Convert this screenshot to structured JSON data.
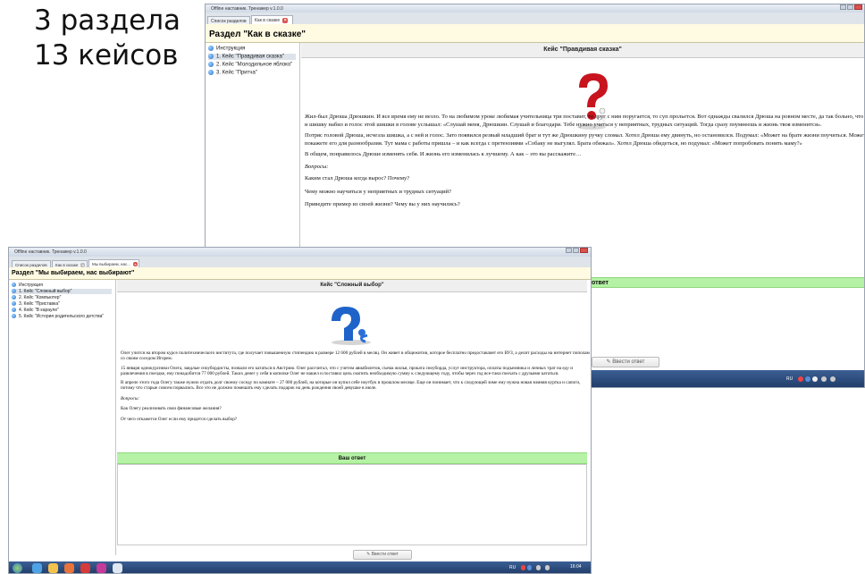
{
  "heading": {
    "line1": "3 раздела",
    "line2": "13 кейсов"
  },
  "window_back": {
    "title": "Offline наставник. Тренажер v.1.0.0",
    "tabs": [
      {
        "label": "Список разделов"
      },
      {
        "label": "Как в сказке"
      }
    ],
    "section_title": "Раздел \"Как в сказке\"",
    "sidebar": [
      {
        "label": "Инструкция"
      },
      {
        "label": "1. Кейс \"Правдивая сказка\""
      },
      {
        "label": "2. Кейс \"Молодильное яблоко\""
      },
      {
        "label": "3. Кейс \"Притча\""
      }
    ],
    "case_title": "Кейс \"Правдивая сказка\"",
    "paragraphs": [
      "Жил-был Дрюша Дрюшкин. И все время ему не везло. То на любимом уроке любимая учительница три поставит, то друг с ним поругается, то суп прольется. Вот однажды свалился Дрюша на ровном месте, да так больно, что и шишку набил и голос этой шишки в голове услышал: «Слушай меня, Дрюшкин. Слушай и благодари. Тебе нужно учиться у неприятных, трудных ситуаций. Тогда сразу поумнеешь и жизнь твоя изменится».",
      "Потряс головой Дрюша, исчезла шишка, а с ней и голос. Зато появился резвый младший брат и тут же Дрюшкину ручку сломал. Хотел Дрюша ему двинуть, но остановился. Подумал: «Может на брате жизни поучиться. Может покажете его для разнообразия. Тут мама с работы пришла – и как всегда с претензиями «Собаку не выгулял. Брата обижал». Хотел Дрюша обидеться, но подумал: «Может попробовать понять маму?»",
      "В общем, понравилось Дрюше изменять себя. И жизнь его изменилась к лучшему. А как – это вы расскажите…"
    ],
    "questions_label": "Вопросы:",
    "questions": [
      "Каким стал Дрюша когда вырос? Почему?",
      "Чему можно научиться у неприятных и трудных ситуаций?",
      "Приведите пример из своей жизни? Чему вы у них научились?"
    ],
    "answer_label": "ответ",
    "enter_answer_button": "Ввести ответ",
    "tray_lang": "RU"
  },
  "window_front": {
    "title": "Offline наставник. Тренажер v.1.0.0",
    "tabs": [
      {
        "label": "Список разделов"
      },
      {
        "label": "Как в сказке"
      },
      {
        "label": "Мы выбираем, нас..."
      }
    ],
    "section_title": "Раздел \"Мы выбираем, нас выбирают\"",
    "sidebar": [
      {
        "label": "Инструкция"
      },
      {
        "label": "1. Кейс \"Сложный выбор\""
      },
      {
        "label": "2. Кейс \"Компьютер\""
      },
      {
        "label": "3. Кейс \"Приставка\""
      },
      {
        "label": "4. Кейс \"В караулe\""
      },
      {
        "label": "5. Кейс \"История родительского детства\""
      }
    ],
    "case_title": "Кейс \"Сложный выбор\"",
    "paragraphs": [
      "Олег учится на втором курсе политехнического института, где получает повышенную стипендию в размере 12 600 рублей в месяц. Он живет в общежитии, которое бесплатно предоставляет его ВУЗ, а делит расходы на интернет пополам со своим соседом Игорем.",
      "15 января однокурсники Олега, заядлые сноубордисты, позвали его кататься в Австрию. Олег рассчитал, что с учетом авиабилетов, съема жилья, проката сноуборда, услуг инструктора, оплаты подъемника и личных трат на еду и развлечения в поездке, ему понадобится 77 000 рублей. Таких денег у себя в копилке Олег не нашел и поставил цель скопить необходимую сумму к следующему году, чтобы через год все-таки поехать с друзьями кататься.",
      "В апреле этого года Олегу также нужно отдать долг своему соседу по комнате – 27 000 рублей, на которые он купил себе ноутбук в прошлом месяце. Еще он понимает, что к следующей зиме ему нужна новая зимняя куртка и сапоги, потому что старые совсем порвались. Все это не должно помешать ему сделать подарок на день рождения своей девушке в июле."
    ],
    "questions_label": "Вопросы:",
    "questions": [
      "Как Олегу реализовать свои финансовые желания?",
      "От чего откажется Олег если ему придется сделать выбор?"
    ],
    "answer_label": "Ваш ответ",
    "enter_answer_button": "Ввести ответ",
    "tray_lang": "RU",
    "clock": "16:04"
  },
  "colors": {
    "section_bg": "#fffbe2",
    "answer_green": "#b5f2a5",
    "taskbar": "#1f3a66",
    "close_red": "#d9534f"
  }
}
